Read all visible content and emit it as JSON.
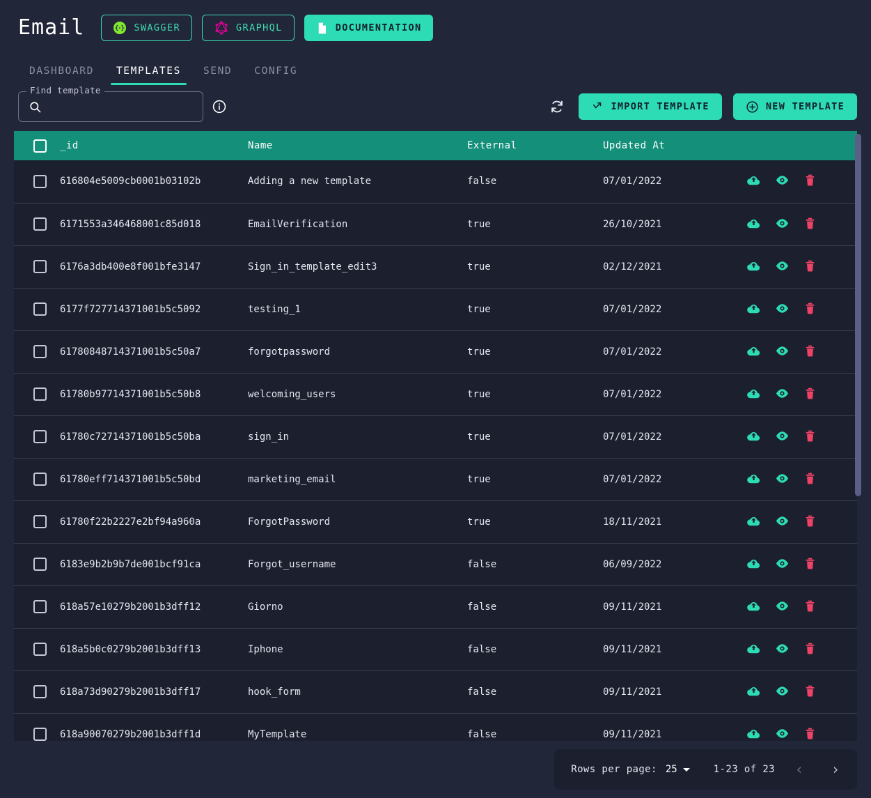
{
  "header": {
    "brand": "Email",
    "buttons": [
      {
        "label": "SWAGGER",
        "icon": "swagger-icon",
        "style": "outline"
      },
      {
        "label": "GRAPHQL",
        "icon": "graphql-icon",
        "style": "outline"
      },
      {
        "label": "DOCUMENTATION",
        "icon": "document-icon",
        "style": "filled"
      }
    ]
  },
  "tabs": [
    {
      "label": "DASHBOARD",
      "active": false
    },
    {
      "label": "TEMPLATES",
      "active": true
    },
    {
      "label": "SEND",
      "active": false
    },
    {
      "label": "CONFIG",
      "active": false
    }
  ],
  "toolbar": {
    "search_label": "Find template",
    "search_value": "",
    "search_placeholder": "",
    "refresh_label": "refresh",
    "import_label": "IMPORT TEMPLATE",
    "new_label": "NEW TEMPLATE"
  },
  "table": {
    "columns": [
      "_id",
      "Name",
      "External",
      "Updated At"
    ],
    "rows": [
      {
        "id": "616804e5009cb0001b03102b",
        "name": "Adding a new template",
        "external": "false",
        "updated": "07/01/2022"
      },
      {
        "id": "6171553a346468001c85d018",
        "name": "EmailVerification",
        "external": "true",
        "updated": "26/10/2021"
      },
      {
        "id": "6176a3db400e8f001bfe3147",
        "name": "Sign_in_template_edit3",
        "external": "true",
        "updated": "02/12/2021"
      },
      {
        "id": "6177f727714371001b5c5092",
        "name": "testing_1",
        "external": "true",
        "updated": "07/01/2022"
      },
      {
        "id": "61780848714371001b5c50a7",
        "name": "forgotpassword",
        "external": "true",
        "updated": "07/01/2022"
      },
      {
        "id": "61780b97714371001b5c50b8",
        "name": "welcoming_users",
        "external": "true",
        "updated": "07/01/2022"
      },
      {
        "id": "61780c72714371001b5c50ba",
        "name": "sign_in",
        "external": "true",
        "updated": "07/01/2022"
      },
      {
        "id": "61780eff714371001b5c50bd",
        "name": "marketing_email",
        "external": "true",
        "updated": "07/01/2022"
      },
      {
        "id": "61780f22b2227e2bf94a960a",
        "name": "ForgotPassword",
        "external": "true",
        "updated": "18/11/2021"
      },
      {
        "id": "6183e9b2b9b7de001bcf91ca",
        "name": "Forgot_username",
        "external": "false",
        "updated": "06/09/2022"
      },
      {
        "id": "618a57e10279b2001b3dff12",
        "name": "Giorno",
        "external": "false",
        "updated": "09/11/2021"
      },
      {
        "id": "618a5b0c0279b2001b3dff13",
        "name": "Iphone",
        "external": "false",
        "updated": "09/11/2021"
      },
      {
        "id": "618a73d90279b2001b3dff17",
        "name": "hook_form",
        "external": "false",
        "updated": "09/11/2021"
      },
      {
        "id": "618a90070279b2001b3dff1d",
        "name": "MyTemplate",
        "external": "false",
        "updated": "09/11/2021"
      }
    ],
    "row_actions": [
      {
        "name": "upload-icon",
        "color": "#2ddbb4"
      },
      {
        "name": "preview-icon",
        "color": "#2ddbb4"
      },
      {
        "name": "delete-icon",
        "color": "#ee4266"
      }
    ]
  },
  "pagination": {
    "rows_per_page_label": "Rows per page:",
    "rows_per_page_value": "25",
    "range": "1-23 of 23",
    "prev": "‹",
    "next": "›"
  },
  "colors": {
    "background": "#222639",
    "row_background": "#1c1f2e",
    "table_header": "#148f7a",
    "accent": "#2ddbb4",
    "danger": "#ee4266",
    "swagger": "#85ea2d",
    "graphql": "#e10098"
  }
}
